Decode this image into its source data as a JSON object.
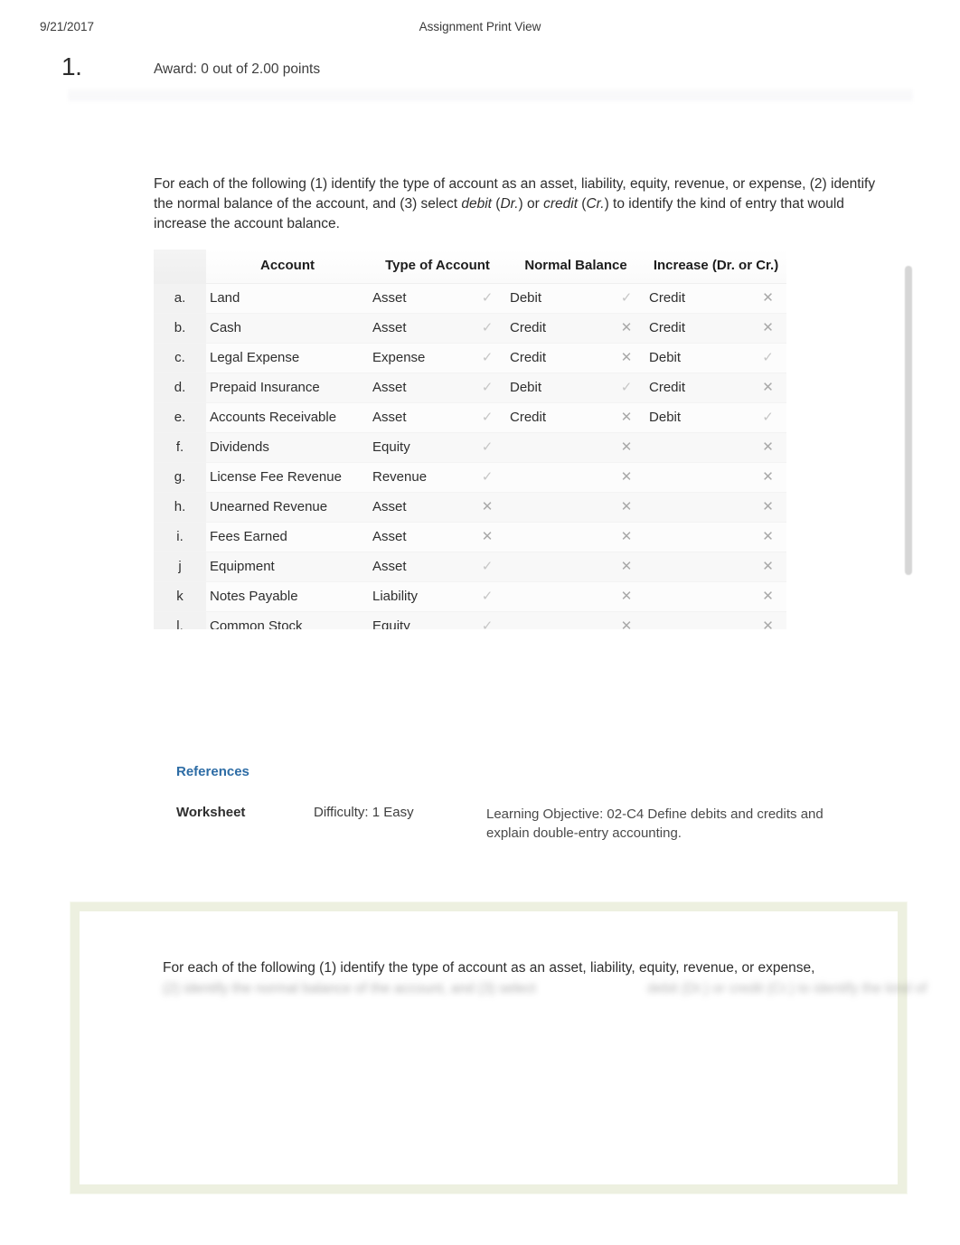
{
  "print_header": {
    "date": "9/21/2017",
    "title": "Assignment Print View"
  },
  "question": {
    "number": "1.",
    "award": "Award: 0 out of 2.00 points"
  },
  "instructions": {
    "part1": "For each of the following (1) identify the type of account as an asset, liability, equity, revenue, or expense, (2) identify the normal balance of the account, and (3) select ",
    "em1": "debit",
    "paren1": " (",
    "em2": "Dr.",
    "paren2": ") or ",
    "em3": "credit",
    "paren3": " (",
    "em4": "Cr.",
    "paren4": ") to identify the kind of entry that would increase the account balance."
  },
  "table": {
    "headers": {
      "blank": "",
      "account": "Account",
      "type_of_account": "Type of Account",
      "normal_balance": "Normal Balance",
      "increase": "Increase (Dr. or Cr.)"
    },
    "marks": {
      "correct": "✓",
      "incorrect": "✕"
    },
    "rows": [
      {
        "letter": "a.",
        "account": "Land",
        "type": "Asset",
        "type_mark": "correct",
        "normal": "Debit",
        "normal_mark": "correct",
        "increase": "Credit",
        "increase_mark": "incorrect"
      },
      {
        "letter": "b.",
        "account": "Cash",
        "type": "Asset",
        "type_mark": "correct",
        "normal": "Credit",
        "normal_mark": "incorrect",
        "increase": "Credit",
        "increase_mark": "incorrect"
      },
      {
        "letter": "c.",
        "account": "Legal Expense",
        "type": "Expense",
        "type_mark": "correct",
        "normal": "Credit",
        "normal_mark": "incorrect",
        "increase": "Debit",
        "increase_mark": "correct"
      },
      {
        "letter": "d.",
        "account": "Prepaid Insurance",
        "type": "Asset",
        "type_mark": "correct",
        "normal": "Debit",
        "normal_mark": "correct",
        "increase": "Credit",
        "increase_mark": "incorrect"
      },
      {
        "letter": "e.",
        "account": "Accounts Receivable",
        "type": "Asset",
        "type_mark": "correct",
        "normal": "Credit",
        "normal_mark": "incorrect",
        "increase": "Debit",
        "increase_mark": "correct"
      },
      {
        "letter": "f.",
        "account": "Dividends",
        "type": "Equity",
        "type_mark": "correct",
        "normal": "",
        "normal_mark": "incorrect",
        "increase": "",
        "increase_mark": "incorrect"
      },
      {
        "letter": "g.",
        "account": "License Fee Revenue",
        "type": "Revenue",
        "type_mark": "correct",
        "normal": "",
        "normal_mark": "incorrect",
        "increase": "",
        "increase_mark": "incorrect"
      },
      {
        "letter": "h.",
        "account": "Unearned Revenue",
        "type": "Asset",
        "type_mark": "incorrect",
        "normal": "",
        "normal_mark": "incorrect",
        "increase": "",
        "increase_mark": "incorrect"
      },
      {
        "letter": "i.",
        "account": "Fees Earned",
        "type": "Asset",
        "type_mark": "incorrect",
        "normal": "",
        "normal_mark": "incorrect",
        "increase": "",
        "increase_mark": "incorrect"
      },
      {
        "letter": "j",
        "account": "Equipment",
        "type": "Asset",
        "type_mark": "correct",
        "normal": "",
        "normal_mark": "incorrect",
        "increase": "",
        "increase_mark": "incorrect"
      },
      {
        "letter": "k",
        "account": "Notes Payable",
        "type": "Liability",
        "type_mark": "correct",
        "normal": "",
        "normal_mark": "incorrect",
        "increase": "",
        "increase_mark": "incorrect"
      },
      {
        "letter": "l.",
        "account": "Common Stock",
        "type": "Equity",
        "type_mark": "correct",
        "normal": "",
        "normal_mark": "incorrect",
        "increase": "",
        "increase_mark": "incorrect"
      }
    ]
  },
  "references": {
    "heading": "References",
    "worksheet": "Worksheet",
    "difficulty": "Difficulty: 1 Easy",
    "objective": "Learning Objective: 02-C4 Define debits and credits and explain double-entry accounting."
  },
  "bottom_box": {
    "text": "For each of the following (1) identify the type of account as an asset, liability, equity, revenue, or expense,",
    "obscured_left": "(2) identify the normal balance of the account, and (3) select",
    "obscured_right": "debit (Dr.) or credit (Cr.) to identify the kind of"
  },
  "colors": {
    "references_link": "#2d6ca5",
    "green_border": "#edf0e0",
    "mark_correct": "#c6c6c6",
    "mark_incorrect": "#a9a9a9"
  }
}
